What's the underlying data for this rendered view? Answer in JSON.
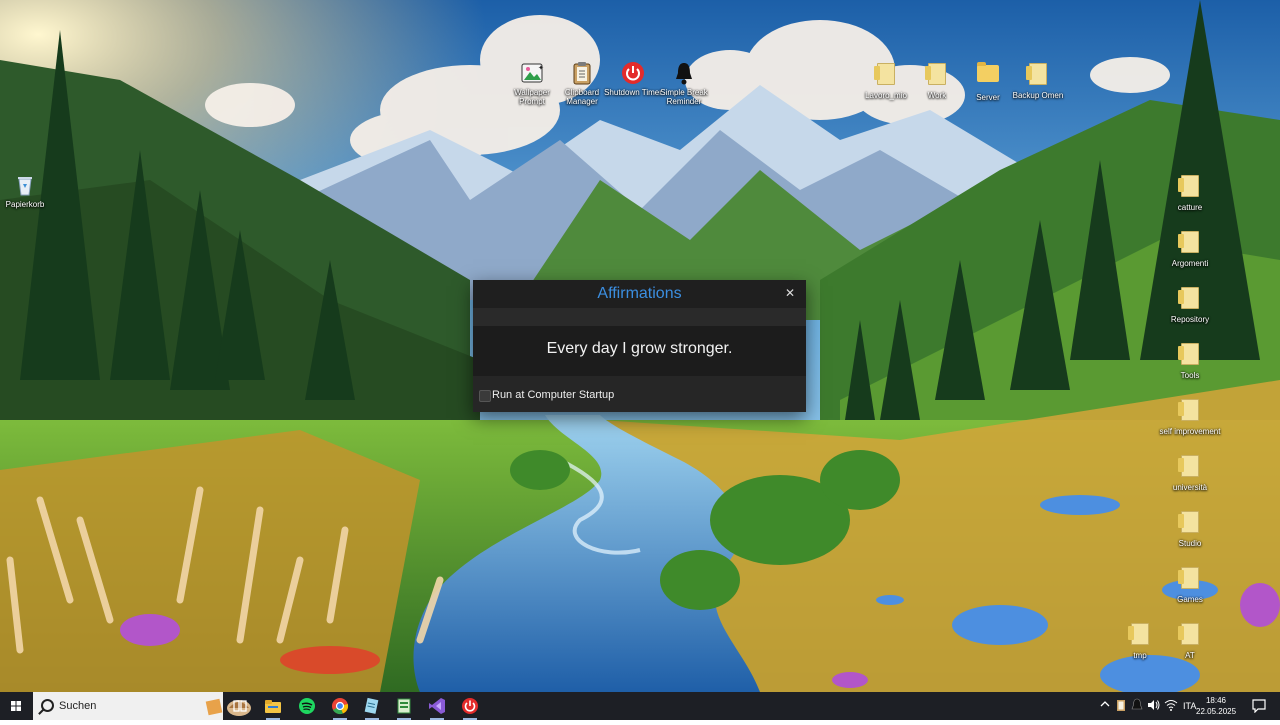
{
  "desktop": {
    "left_icons": [
      {
        "label": "Papierkorb",
        "icon": "recycle-bin-icon"
      }
    ],
    "top_icons": [
      {
        "label": "Wallpaper Prompt",
        "icon": "wallpaper-prompt-icon"
      },
      {
        "label": "Clipboard Manager",
        "icon": "clipboard-icon"
      },
      {
        "label": "Shutdown Timer",
        "icon": "power-icon"
      },
      {
        "label": "Simple Break Reminder",
        "icon": "bell-icon"
      },
      {
        "label": "Lavoro_mio",
        "icon": "folder-icon"
      },
      {
        "label": "Work",
        "icon": "folder-icon"
      },
      {
        "label": "Server",
        "icon": "folder-icon"
      },
      {
        "label": "Backup Omen",
        "icon": "folder-icon"
      }
    ],
    "right_icons": [
      {
        "label": "catture",
        "icon": "folder-icon"
      },
      {
        "label": "Argomenti",
        "icon": "folder-icon"
      },
      {
        "label": "Repository",
        "icon": "folder-icon"
      },
      {
        "label": "Tools",
        "icon": "folder-icon"
      },
      {
        "label": "self improvement",
        "icon": "folder-icon"
      },
      {
        "label": "università",
        "icon": "folder-icon"
      },
      {
        "label": "Studio",
        "icon": "folder-icon"
      },
      {
        "label": "Games",
        "icon": "folder-icon"
      },
      {
        "label": "tmp",
        "icon": "folder-icon"
      },
      {
        "label": "AT",
        "icon": "folder-icon"
      }
    ]
  },
  "dialog": {
    "title": "Affirmations",
    "close_glyph": "✕",
    "message": "Every day I grow stronger.",
    "startup_label": "Run at Computer Startup",
    "startup_checked": false
  },
  "taskbar": {
    "search_placeholder": "Suchen",
    "apps": [
      "task-view-icon",
      "file-explorer-icon",
      "spotify-icon",
      "chrome-icon",
      "notepad-icon",
      "spreadsheet-icon",
      "visual-studio-icon",
      "shutdown-timer-icon"
    ],
    "language": "ITA",
    "time": "18:46",
    "date": "22.05.2025"
  },
  "colors": {
    "dialog_title": "#3b8ee0",
    "dialog_bg": "#232323",
    "taskbar_bg": "#1d1f25"
  }
}
